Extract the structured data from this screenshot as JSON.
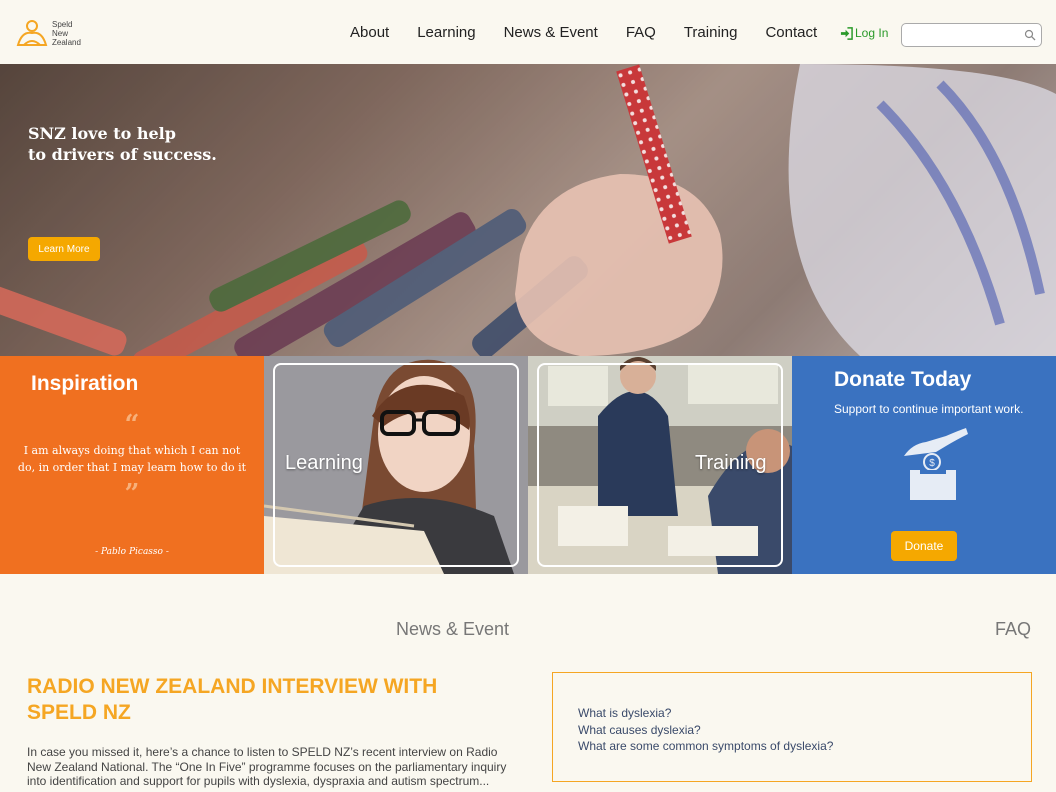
{
  "header": {
    "logo_text": [
      "Speld",
      "New",
      "Zealand"
    ],
    "nav": [
      "About",
      "Learning",
      "News & Event",
      "FAQ",
      "Training",
      "Contact"
    ],
    "login_label": "Log In",
    "search_placeholder": ""
  },
  "hero": {
    "title_line1": "SNZ love to help",
    "title_line2": "to drivers of success.",
    "button_label": "Learn More"
  },
  "tiles": {
    "inspiration": {
      "title": "Inspiration",
      "open_quote": "“",
      "quote": "I am always doing that which I can not do, in order that I may learn how to do it",
      "close_quote": "”",
      "author": "- Pablo Picasso -"
    },
    "learning": {
      "label": "Learning"
    },
    "training": {
      "label": "Training"
    },
    "donate": {
      "title": "Donate Today",
      "subtitle": "Support to continue important work.",
      "button_label": "Donate"
    }
  },
  "news": {
    "section_label": "News & Event",
    "title": "RADIO NEW ZEALAND INTERVIEW WITH SPELD NZ",
    "body": "In case you missed it, here’s a chance to listen to SPELD NZ’s recent interview on Radio New Zealand National. The “One In Five” programme focuses on the parliamentary inquiry into identification and support for pupils with dyslexia, dyspraxia and autism spectrum..."
  },
  "faq": {
    "section_label": "FAQ",
    "items": [
      "What is dyslexia?",
      "What causes dyslexia?",
      "What are some common symptoms of dyslexia?"
    ]
  },
  "colors": {
    "accent_orange": "#f07020",
    "button_yellow": "#f5a800",
    "donate_blue": "#3a72c0",
    "login_green": "#2a9a2a",
    "news_title": "#f5a623"
  }
}
